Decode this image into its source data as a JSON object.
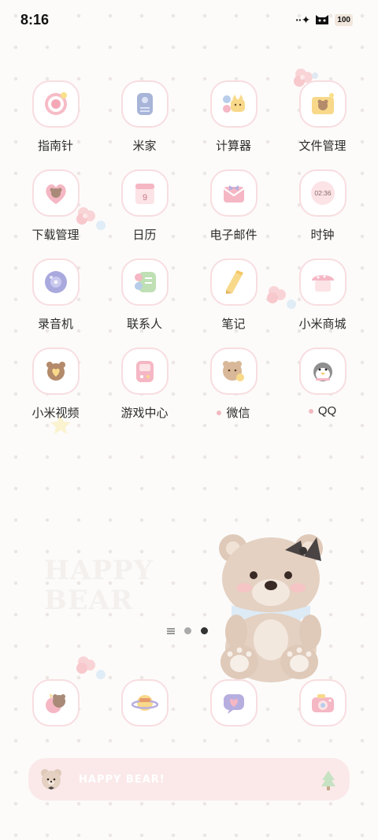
{
  "status_bar": {
    "time": "8:16",
    "signal_glyph": "··✦",
    "battery": "100"
  },
  "apps": [
    {
      "label": "指南针",
      "icon": "compass-icon",
      "dot": false
    },
    {
      "label": "米家",
      "icon": "mijia-icon",
      "dot": false
    },
    {
      "label": "计算器",
      "icon": "calculator-icon",
      "dot": false
    },
    {
      "label": "文件管理",
      "icon": "file-manager-icon",
      "dot": false
    },
    {
      "label": "下载管理",
      "icon": "download-icon",
      "dot": false
    },
    {
      "label": "日历",
      "icon": "calendar-icon",
      "dot": false,
      "day": "9"
    },
    {
      "label": "电子邮件",
      "icon": "email-icon",
      "dot": false
    },
    {
      "label": "时钟",
      "icon": "clock-icon",
      "dot": false,
      "clock_text": "02:36"
    },
    {
      "label": "录音机",
      "icon": "recorder-icon",
      "dot": false
    },
    {
      "label": "联系人",
      "icon": "contacts-icon",
      "dot": false
    },
    {
      "label": "笔记",
      "icon": "notes-icon",
      "dot": false
    },
    {
      "label": "小米商城",
      "icon": "mi-store-icon",
      "dot": false
    },
    {
      "label": "小米视频",
      "icon": "mi-video-icon",
      "dot": false
    },
    {
      "label": "游戏中心",
      "icon": "game-center-icon",
      "dot": false
    },
    {
      "label": "微信",
      "icon": "wechat-icon",
      "dot": true
    },
    {
      "label": "QQ",
      "icon": "qq-icon",
      "dot": true
    }
  ],
  "wallpaper": {
    "happy_line1": "HAPPY",
    "happy_line2": "BEAR"
  },
  "dock": [
    {
      "icon": "phone-icon"
    },
    {
      "icon": "browser-planet-icon"
    },
    {
      "icon": "messages-icon"
    },
    {
      "icon": "camera-icon"
    }
  ],
  "search_bar": {
    "text": "HAPPY BEAR!"
  },
  "colors": {
    "icon_border": "#f8dde0",
    "search_bg": "#fbe9ea",
    "dot_pattern": "#ece6e3"
  }
}
